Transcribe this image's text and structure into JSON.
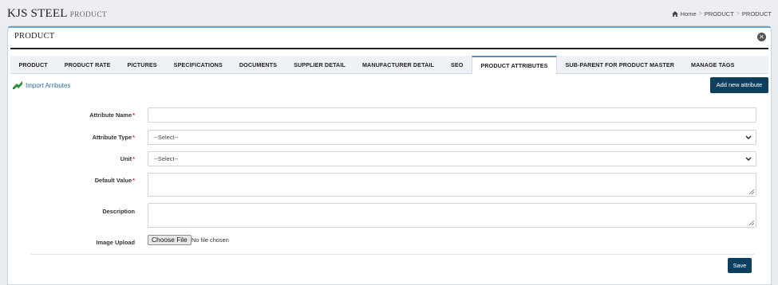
{
  "header": {
    "brand": "KJS STEEL",
    "brand_sub": "PRODUCT",
    "breadcrumb": [
      "Home",
      "PRODUCT",
      "PRODUCT"
    ],
    "breadcrumb_separator": ">"
  },
  "panel": {
    "title": "PRODUCT",
    "close_icon": "close-circle-icon"
  },
  "tabs": [
    {
      "label": "PRODUCT",
      "active": false
    },
    {
      "label": "PRODUCT RATE",
      "active": false
    },
    {
      "label": "PICTURES",
      "active": false
    },
    {
      "label": "SPECIFICATIONS",
      "active": false
    },
    {
      "label": "DOCUMENTS",
      "active": false
    },
    {
      "label": "SUPPLIER DETAIL",
      "active": false
    },
    {
      "label": "MANUFACTURER DETAIL",
      "active": false
    },
    {
      "label": "SEO",
      "active": false
    },
    {
      "label": "PRODUCT ATTRIBUTES",
      "active": true
    },
    {
      "label": "SUB-PARENT FOR PRODUCT MASTER",
      "active": false
    },
    {
      "label": "MANAGE TAGS",
      "active": false
    }
  ],
  "actions": {
    "import_label": "Import Arributes",
    "add_label": "Add new attribute",
    "save_label": "Save"
  },
  "form": {
    "attribute_name": {
      "label": "Attribute Name",
      "required": "*",
      "value": ""
    },
    "attribute_type": {
      "label": "Attribute Type",
      "required": "*",
      "selected": "--Select--"
    },
    "unit": {
      "label": "Unit",
      "required": "*",
      "selected": "--Select--"
    },
    "default_value": {
      "label": "Default Value",
      "required": "*",
      "value": ""
    },
    "description": {
      "label": "Description",
      "value": ""
    },
    "image_upload": {
      "label": "Image Upload",
      "button": "Choose File",
      "status": "No file chosen"
    }
  },
  "colors": {
    "primary_button": "#0f3f5f",
    "link": "#2d6ea3",
    "required": "#c0392b"
  }
}
